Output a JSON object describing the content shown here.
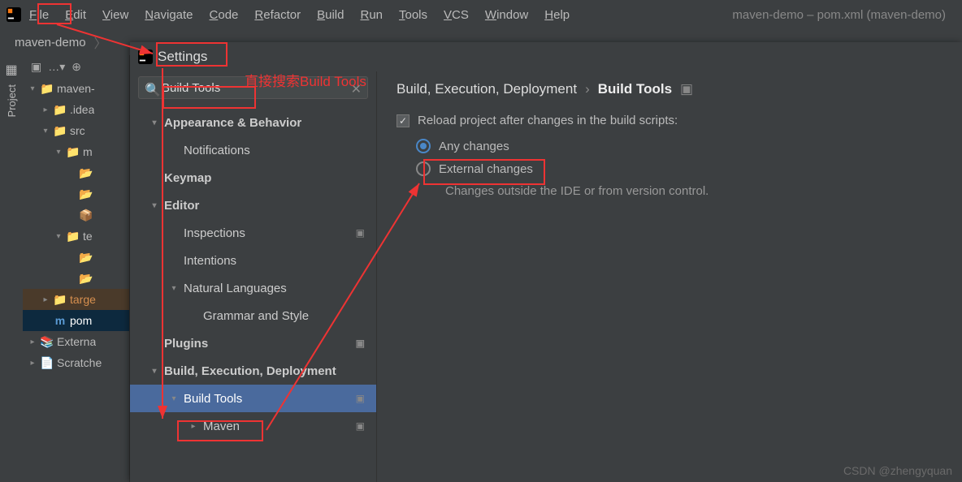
{
  "menubar": {
    "items": [
      "File",
      "Edit",
      "View",
      "Navigate",
      "Code",
      "Refactor",
      "Build",
      "Run",
      "Tools",
      "VCS",
      "Window",
      "Help"
    ],
    "title": "maven-demo – pom.xml (maven-demo)"
  },
  "breadcrumb": {
    "root": "maven-demo"
  },
  "tool_tab": {
    "label": "Project"
  },
  "tree": {
    "items": [
      {
        "label": "maven-",
        "depth": 0,
        "caret": "v",
        "type": "module"
      },
      {
        "label": ".idea",
        "depth": 1,
        "caret": ">",
        "type": "folder"
      },
      {
        "label": "src",
        "depth": 1,
        "caret": "v",
        "type": "folder"
      },
      {
        "label": "m",
        "depth": 2,
        "caret": "v",
        "type": "folder"
      },
      {
        "label": "",
        "depth": 3,
        "caret": "",
        "type": "src"
      },
      {
        "label": "",
        "depth": 3,
        "caret": "",
        "type": "res"
      },
      {
        "label": "",
        "depth": 3,
        "caret": "",
        "type": "pkg"
      },
      {
        "label": "te",
        "depth": 2,
        "caret": "v",
        "type": "folder"
      },
      {
        "label": "",
        "depth": 3,
        "caret": "",
        "type": "test"
      },
      {
        "label": "",
        "depth": 3,
        "caret": "",
        "type": "testres"
      },
      {
        "label": "targe",
        "depth": 1,
        "caret": ">",
        "type": "target",
        "cls": "target-row"
      },
      {
        "label": "pom",
        "depth": 1,
        "caret": "",
        "type": "pom",
        "cls": "pom-row"
      },
      {
        "label": "Externa",
        "depth": 0,
        "caret": ">",
        "type": "lib"
      },
      {
        "label": "Scratche",
        "depth": 0,
        "caret": ">",
        "type": "scratch"
      }
    ]
  },
  "settings": {
    "title": "Settings",
    "search": "Build Tools",
    "nav": [
      {
        "label": "Appearance & Behavior",
        "depth": 0,
        "bold": true,
        "caret": "v"
      },
      {
        "label": "Notifications",
        "depth": 1,
        "caret": ""
      },
      {
        "label": "Keymap",
        "depth": 0,
        "bold": true,
        "caret": ""
      },
      {
        "label": "Editor",
        "depth": 0,
        "bold": true,
        "caret": "v"
      },
      {
        "label": "Inspections",
        "depth": 1,
        "caret": "",
        "proj": true
      },
      {
        "label": "Intentions",
        "depth": 1,
        "caret": ""
      },
      {
        "label": "Natural Languages",
        "depth": 1,
        "caret": "v"
      },
      {
        "label": "Grammar and Style",
        "depth": 2,
        "caret": ""
      },
      {
        "label": "Plugins",
        "depth": 0,
        "bold": true,
        "caret": "",
        "proj": true
      },
      {
        "label": "Build, Execution, Deployment",
        "depth": 0,
        "bold": true,
        "caret": "v"
      },
      {
        "label": "Build Tools",
        "depth": 1,
        "caret": "v",
        "selected": true,
        "proj": true
      },
      {
        "label": "Maven",
        "depth": 2,
        "caret": ">",
        "proj": true
      }
    ],
    "content": {
      "path1": "Build, Execution, Deployment",
      "path2": "Build Tools",
      "check_label": "Reload project after changes in the build scripts:",
      "opt1": "Any changes",
      "opt2": "External changes",
      "desc": "Changes outside the IDE or from version control."
    }
  },
  "annotation": {
    "text": "直接搜索Build Tools"
  },
  "watermark": "CSDN @zhengyquan"
}
